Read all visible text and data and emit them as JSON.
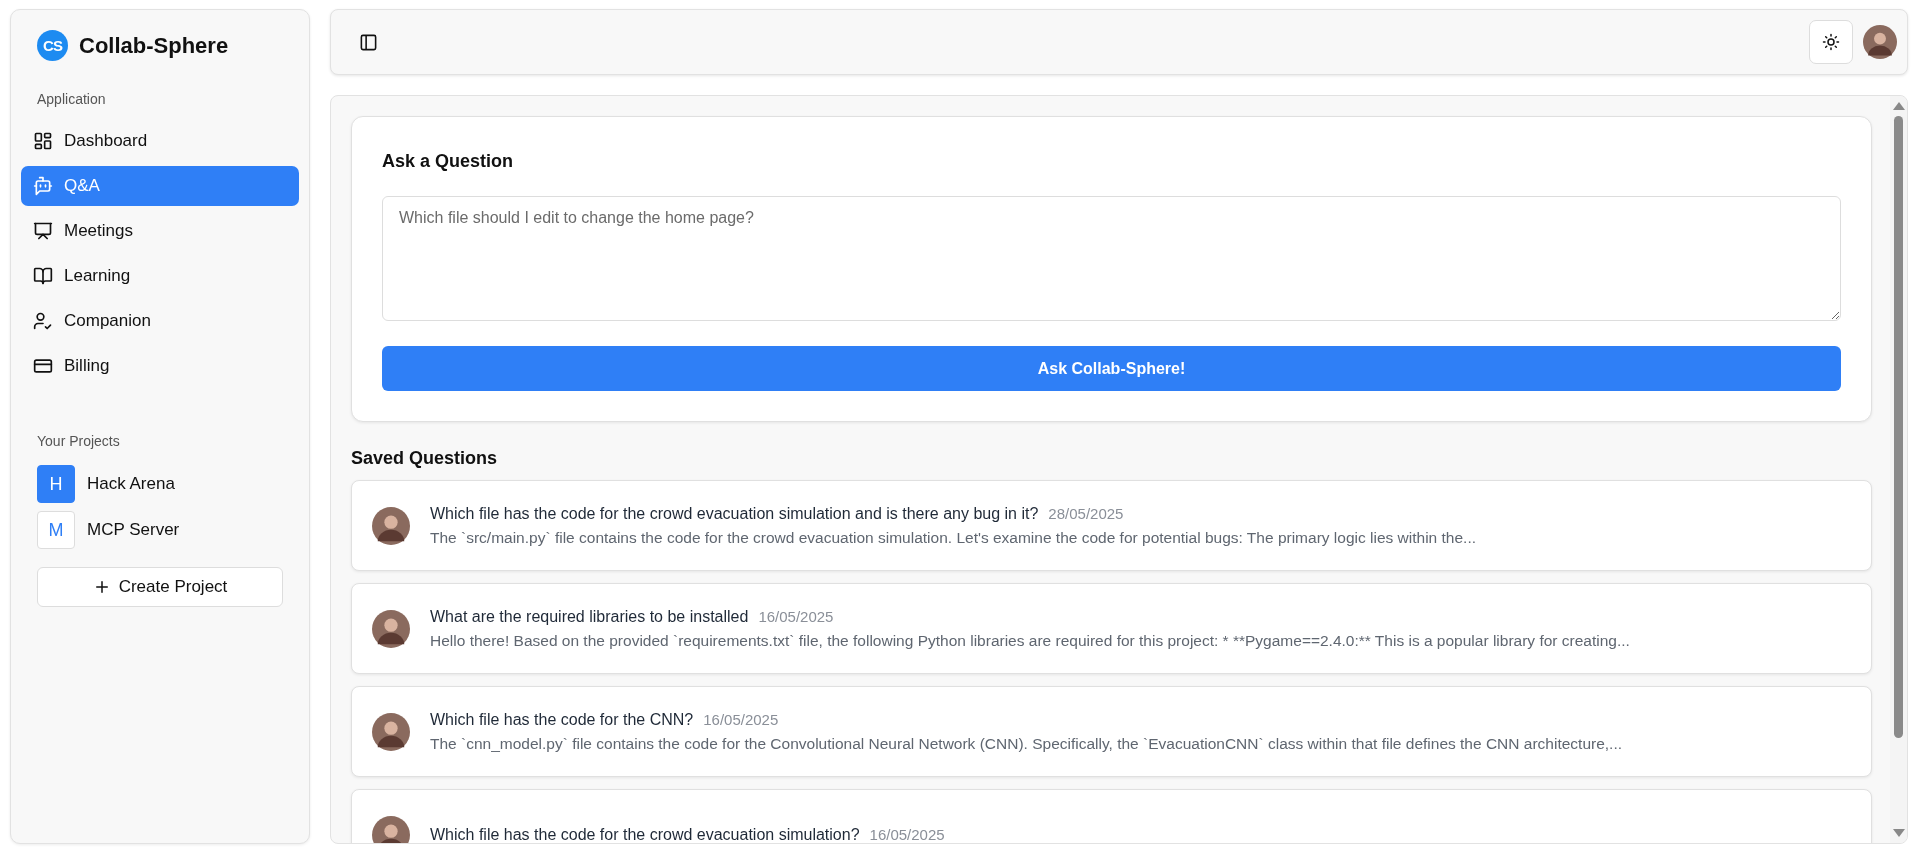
{
  "sidebar": {
    "logo": {
      "mark": "CS",
      "name": "Collab-Sphere"
    },
    "section_title": "Application",
    "items": [
      {
        "label": "Dashboard",
        "selected": false
      },
      {
        "label": "Q&A",
        "selected": true
      },
      {
        "label": "Meetings",
        "selected": false
      },
      {
        "label": "Learning",
        "selected": false
      },
      {
        "label": "Companion",
        "selected": false
      },
      {
        "label": "Billing",
        "selected": false
      }
    ],
    "projects_title": "Your Projects",
    "projects": [
      {
        "initial": "H",
        "name": "Hack Arena",
        "selected": true
      },
      {
        "initial": "M",
        "name": "MCP Server",
        "selected": false
      }
    ],
    "create_button": "Create Project"
  },
  "ask": {
    "title": "Ask a Question",
    "placeholder": "Which file should I edit to change the home page?",
    "button": "Ask Collab-Sphere!"
  },
  "saved": {
    "title": "Saved Questions",
    "questions": [
      {
        "question": "Which file has the code for the crowd evacuation simulation and is there any bug in it?",
        "date": "28/05/2025",
        "answer": "The `src/main.py` file contains the code for the crowd evacuation simulation. Let's examine the code for potential bugs: The primary logic lies within the..."
      },
      {
        "question": "What are the required libraries to be installed",
        "date": "16/05/2025",
        "answer": "Hello there! Based on the provided `requirements.txt` file, the following Python libraries are required for this project: * **Pygame==2.4.0:** This is a popular library for creating..."
      },
      {
        "question": "Which file has the code for the CNN?",
        "date": "16/05/2025",
        "answer": "The `cnn_model.py` file contains the code for the Convolutional Neural Network (CNN). Specifically, the `EvacuationCNN` class within that file defines the CNN architecture,..."
      },
      {
        "question": "Which file has the code for the crowd evacuation simulation?",
        "date": "16/05/2025"
      }
    ]
  }
}
